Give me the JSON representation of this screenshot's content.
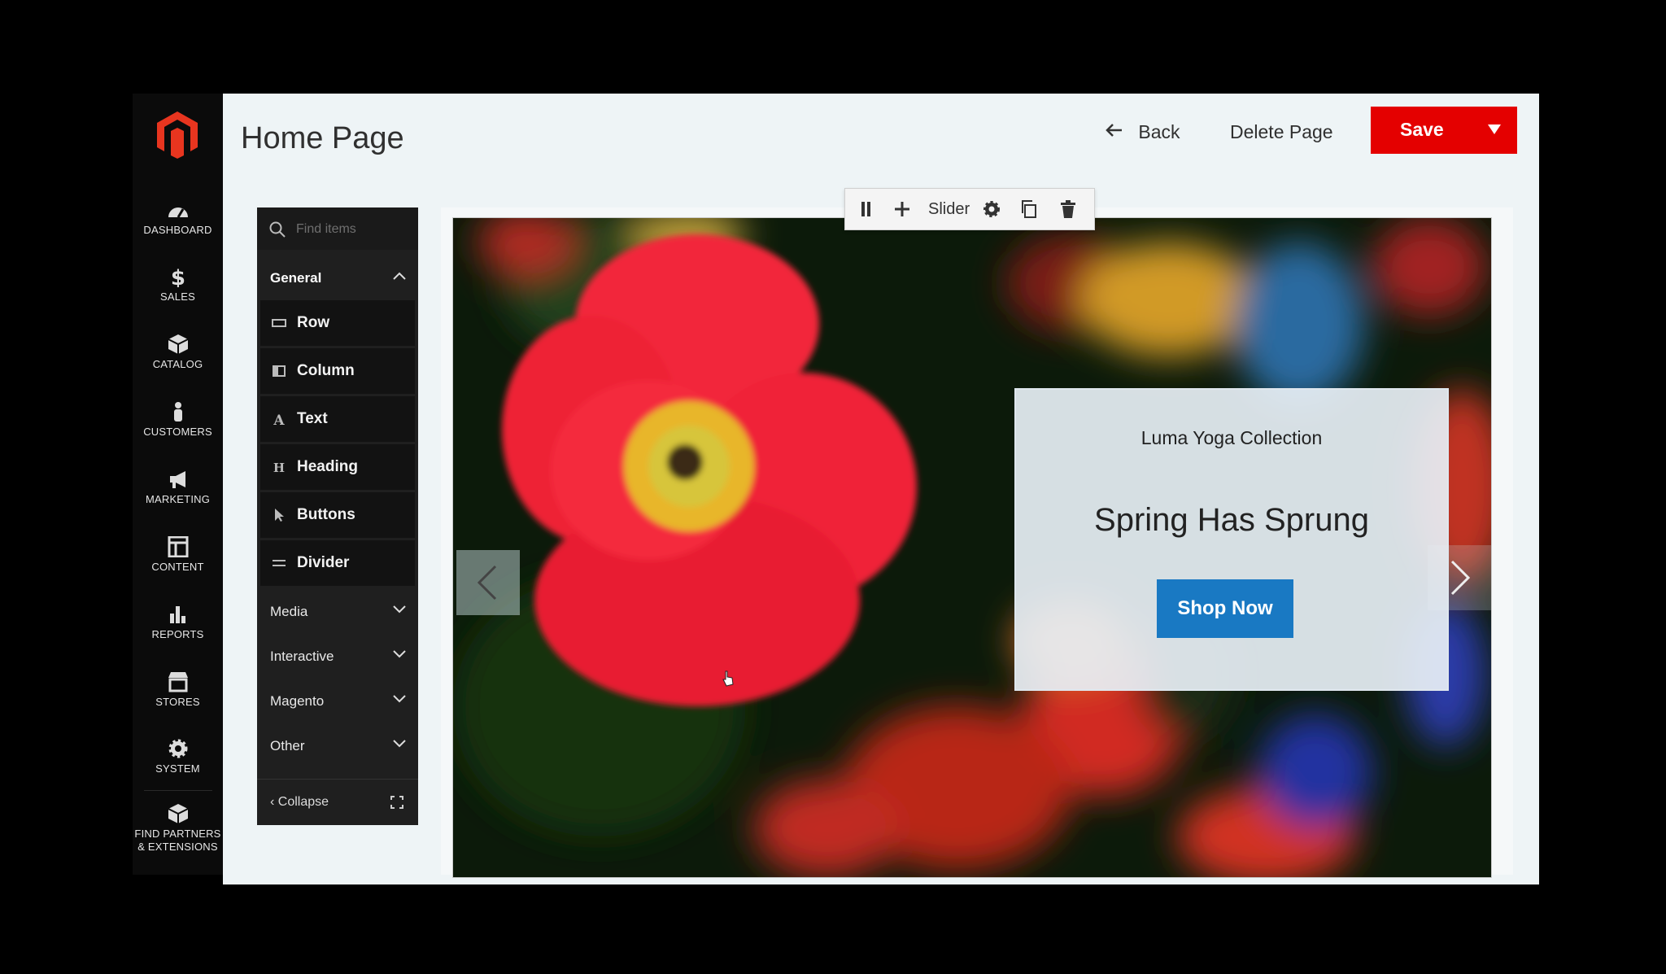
{
  "app": {
    "page_title": "Home Page"
  },
  "header": {
    "back_label": "Back",
    "delete_label": "Delete Page",
    "save_label": "Save"
  },
  "admin_nav": {
    "items": [
      {
        "label": "DASHBOARD",
        "icon": "dashboard-icon"
      },
      {
        "label": "SALES",
        "icon": "dollar-icon"
      },
      {
        "label": "CATALOG",
        "icon": "box-icon"
      },
      {
        "label": "CUSTOMERS",
        "icon": "person-icon"
      },
      {
        "label": "MARKETING",
        "icon": "megaphone-icon"
      },
      {
        "label": "CONTENT",
        "icon": "layout-icon"
      },
      {
        "label": "REPORTS",
        "icon": "bar-chart-icon"
      },
      {
        "label": "STORES",
        "icon": "storefront-icon"
      },
      {
        "label": "SYSTEM",
        "icon": "gear-icon"
      }
    ],
    "partners_line1": "FIND PARTNERS",
    "partners_line2": "& EXTENSIONS"
  },
  "panel": {
    "search_placeholder": "Find items",
    "groups": {
      "general": "General",
      "media": "Media",
      "interactive": "Interactive",
      "magento": "Magento",
      "other": "Other"
    },
    "items": [
      {
        "label": "Row",
        "icon": "row-icon"
      },
      {
        "label": "Column",
        "icon": "column-icon"
      },
      {
        "label": "Text",
        "icon": "text-icon"
      },
      {
        "label": "Heading",
        "icon": "heading-icon"
      },
      {
        "label": "Buttons",
        "icon": "pointer-icon"
      },
      {
        "label": "Divider",
        "icon": "divider-icon"
      }
    ],
    "collapse_label": "Collapse"
  },
  "slider": {
    "toolbar_label": "Slider",
    "banner": {
      "subtitle": "Luma Yoga Collection",
      "heading": "Spring Has Sprung",
      "button_label": "Shop Now"
    }
  },
  "colors": {
    "save": "#e40000",
    "shop_button": "#1979c3",
    "nav_bg": "#0b0b0b",
    "logo": "#e8351f"
  }
}
